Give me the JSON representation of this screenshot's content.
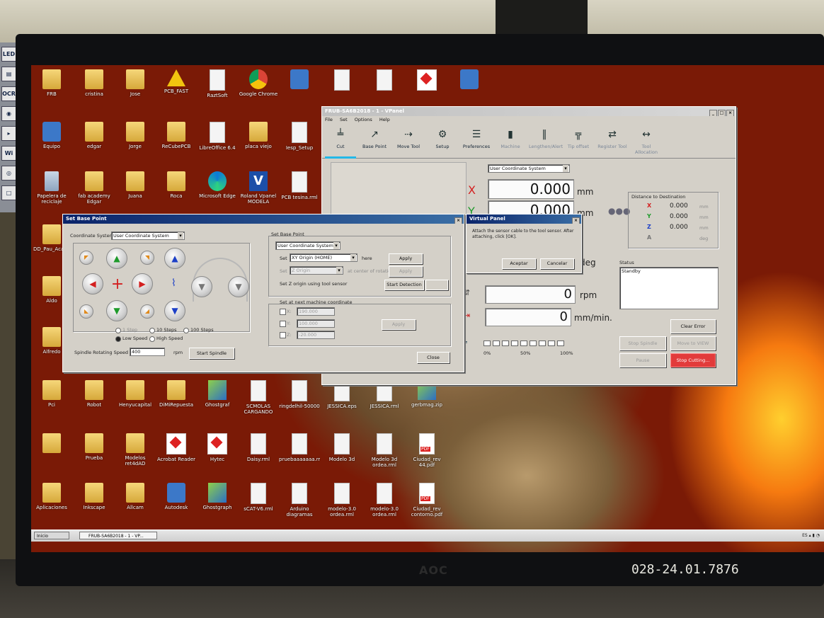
{
  "monitor": {
    "brand": "AOC",
    "asset_tag": "028-24.01.7876"
  },
  "desktop_icons": [
    {
      "label": "FRB",
      "glyph": "folder"
    },
    {
      "label": "cristina",
      "glyph": "folder"
    },
    {
      "label": "Jose",
      "glyph": "folder"
    },
    {
      "label": "PCB_FAST",
      "glyph": "warn"
    },
    {
      "label": "RaztSoft",
      "glyph": "doc"
    },
    {
      "label": "Google Chrome",
      "glyph": "chrome"
    },
    {
      "label": "",
      "glyph": "app"
    },
    {
      "label": "",
      "glyph": "doc"
    },
    {
      "label": "",
      "glyph": "doc"
    },
    {
      "label": "",
      "glyph": "acro"
    },
    {
      "label": "",
      "glyph": "app"
    },
    {
      "label": "Equipo",
      "glyph": "app"
    },
    {
      "label": "edgar",
      "glyph": "folder"
    },
    {
      "label": "Jorge",
      "glyph": "folder"
    },
    {
      "label": "ReCubePCB",
      "glyph": "folder"
    },
    {
      "label": "LibreOffice 6.4",
      "glyph": "doc"
    },
    {
      "label": "placa viejo",
      "glyph": "folder"
    },
    {
      "label": "Iesp_Setup",
      "glyph": "doc"
    },
    {
      "label": "Papelera de reciclaje",
      "glyph": "bin"
    },
    {
      "label": "fab academy Edgar",
      "glyph": "folder"
    },
    {
      "label": "Juana",
      "glyph": "folder"
    },
    {
      "label": "Roca",
      "glyph": "folder"
    },
    {
      "label": "Microsoft Edge",
      "glyph": "edge"
    },
    {
      "label": "Roland Vpanel MODELA",
      "glyph": "v"
    },
    {
      "label": "PCB tesina.rml",
      "glyph": "doc"
    },
    {
      "label": "DD_Pau_Acabe",
      "glyph": "folder"
    },
    {
      "label": "Aldo",
      "glyph": "folder"
    },
    {
      "label": "Alfredo",
      "glyph": "folder"
    },
    {
      "label": "Pci",
      "glyph": "folder"
    },
    {
      "label": "Robot",
      "glyph": "folder"
    },
    {
      "label": "Henyucapital",
      "glyph": "folder"
    },
    {
      "label": "DiMiRepuesta",
      "glyph": "folder"
    },
    {
      "label": "Ghostgraf",
      "glyph": "img"
    },
    {
      "label": "SCMOLAS CARGANDO",
      "glyph": "doc"
    },
    {
      "label": "ringdelhil-50000",
      "glyph": "doc"
    },
    {
      "label": "JESSICA.eps",
      "glyph": "doc"
    },
    {
      "label": "JESSICA.rml",
      "glyph": "doc"
    },
    {
      "label": "gerbmag.zip",
      "glyph": "img"
    },
    {
      "label": "",
      "glyph": "folder"
    },
    {
      "label": "Prueba",
      "glyph": "folder"
    },
    {
      "label": "Modelos ret4dAD",
      "glyph": "folder"
    },
    {
      "label": "Acrobat Reader",
      "glyph": "acro"
    },
    {
      "label": "Hytec",
      "glyph": "acro"
    },
    {
      "label": "Daisy.rml",
      "glyph": "doc"
    },
    {
      "label": "pruebaaaaaaa.rml",
      "glyph": "doc"
    },
    {
      "label": "Modelo 3d",
      "glyph": "doc"
    },
    {
      "label": "Modelo 3d ordea.rml",
      "glyph": "doc"
    },
    {
      "label": "Ciudad_rev 44.pdf",
      "glyph": "pdf"
    },
    {
      "label": "Aplicaciones",
      "glyph": "folder"
    },
    {
      "label": "Inkscape",
      "glyph": "folder"
    },
    {
      "label": "Allcam",
      "glyph": "folder"
    },
    {
      "label": "Autodesk",
      "glyph": "app"
    },
    {
      "label": "Ghostgraph",
      "glyph": "img"
    },
    {
      "label": "sCAT-V6.rml",
      "glyph": "doc"
    },
    {
      "label": "Arduino diagramas",
      "glyph": "doc"
    },
    {
      "label": "modelo-3.0 ordea.rml",
      "glyph": "doc"
    },
    {
      "label": "modelo-3.0 ordea.rml",
      "glyph": "doc"
    },
    {
      "label": "Ciudad_rev contorno.pdf",
      "glyph": "pdf"
    }
  ],
  "taskbar": {
    "start": "Inicio",
    "task": "FRUB-SA6B2018 - 1 - VP...",
    "lang": "ES"
  },
  "vpanel": {
    "title": "FRUB-SA6B2018 - 1 - VPanel",
    "menu": [
      "File",
      "Set",
      "Options",
      "Help"
    ],
    "tools": [
      {
        "label": "Cut",
        "icon": "╧"
      },
      {
        "label": "Base Point",
        "icon": "↗"
      },
      {
        "label": "Move Tool",
        "icon": "⇢"
      },
      {
        "label": "Setup",
        "icon": "⚙"
      },
      {
        "label": "Preferences",
        "icon": "☰"
      },
      {
        "label": "Machine",
        "icon": "▮"
      },
      {
        "label": "Lengthen/Alert",
        "icon": "‖"
      },
      {
        "label": "Tip offset",
        "icon": "╦"
      },
      {
        "label": "Register Tool",
        "icon": "⇄"
      },
      {
        "label": "Tool Allocation",
        "icon": "↔"
      }
    ],
    "coord_select": "User Coordinate System",
    "x_value": "0.000",
    "y_value": "0.000",
    "unit_mm": "mm",
    "unit_deg": "deg",
    "axis_x": "X",
    "axis_y": "Y",
    "spindle_value": "0",
    "spindle_unit": "rpm",
    "feed_value": "0",
    "feed_unit": "mm/min.",
    "progress_labels": [
      "0%",
      "50%",
      "100%"
    ],
    "progress": 0,
    "distance": {
      "title": "Distance to Destination",
      "rows": [
        {
          "axis": "X",
          "value": "0.000",
          "unit": "mm",
          "color": "#d32020"
        },
        {
          "axis": "Y",
          "value": "0.000",
          "unit": "mm",
          "color": "#1d9a2a"
        },
        {
          "axis": "Z",
          "value": "0.000",
          "unit": "mm",
          "color": "#1c3fc7"
        },
        {
          "axis": "A",
          "value": "",
          "unit": "deg",
          "color": "#777777"
        }
      ]
    },
    "status_label": "Status",
    "status_text": "Standby",
    "clear_error": "Clear Error",
    "stop_spindle": "Stop Spindle",
    "move_to_view": "Move to VIEW",
    "pause": "Pause",
    "stop_cutting": "Stop Cutting..."
  },
  "setbase": {
    "title": "Set Base Point",
    "coord_label": "Coordinate System",
    "coord_value": "User Coordinate System",
    "step_1": "1 Step",
    "step_10": "10 Steps",
    "step_100": "100 Steps",
    "low_speed": "Low Speed",
    "high_speed": "High Speed",
    "spindle_label": "Spindle Rotating Speed",
    "spindle_value": "400",
    "spindle_unit": "rpm",
    "start_spindle": "Start Spindle",
    "group1": "Set Base Point",
    "coord2": "User Coordinate System",
    "set_label": "Set",
    "xy_origin": "XY Origin (HOME)",
    "here": "here",
    "apply": "Apply",
    "z_origin": "Z Origin",
    "z_label": "Set",
    "z_note": "at center of rotation",
    "z_sensor": "Set Z origin using tool sensor",
    "start_detection": "Start Detection",
    "group2": "Set at next machine coordinate",
    "x_lbl": "X:",
    "x_val": "190.000",
    "y_lbl": "Y:",
    "y_val": "100.000",
    "z_lbl": "Z:",
    "z_val": "-20.000",
    "apply2": "Apply",
    "close": "Close"
  },
  "dialog": {
    "title": "Virtual Panel",
    "message": "Attach the sensor cable to the tool sensor. After attaching, click [OK].",
    "ok": "Aceptar",
    "cancel": "Cancelar"
  }
}
